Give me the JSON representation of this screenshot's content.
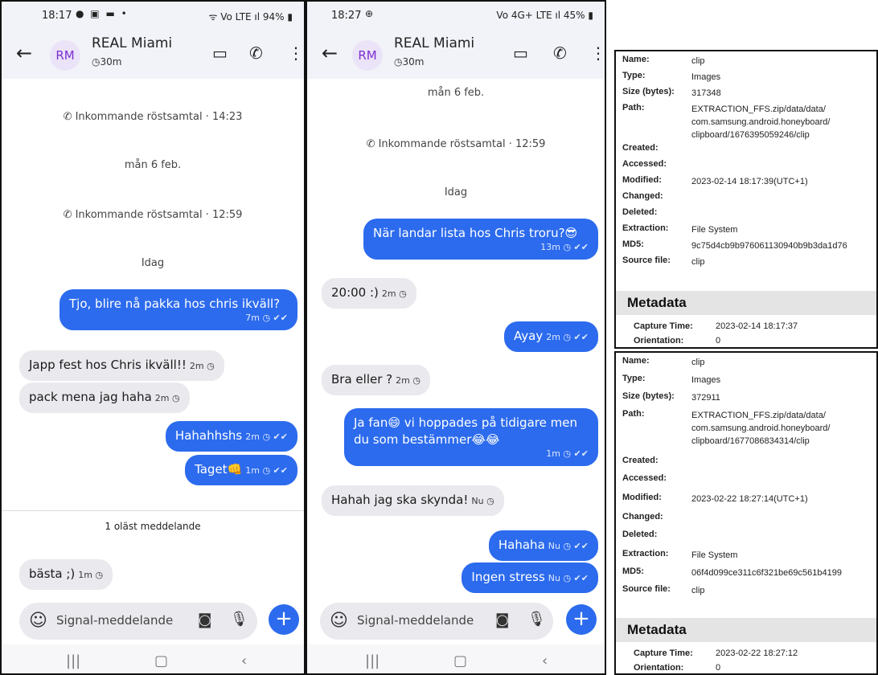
{
  "phone1": {
    "status": {
      "time": "18:17",
      "icons": "● ▣ ▬ •",
      "right": "ᯤ Vo LTE ıl 94% ▮"
    },
    "header": {
      "avatar": "RM",
      "contact": "REAL Miami",
      "timer": "30m"
    },
    "system": [
      {
        "text": "Inkommande röstsamtal · 14:23",
        "icon": "incoming-call-icon"
      },
      {
        "text": "mån 6 feb."
      },
      {
        "text": "Inkommande röstsamtal · 12:59",
        "icon": "incoming-call-icon"
      },
      {
        "text": "Idag"
      }
    ],
    "messages": [
      {
        "text": "Tjo, blire nå pakka hos chris ikväll?",
        "meta": "7m ◷ ✔✔",
        "dir": "out"
      },
      {
        "text": "Japp fest hos Chris ikväll!!",
        "meta": "2m ◷",
        "dir": "in"
      },
      {
        "text": "pack mena jag haha",
        "meta": "2m ◷",
        "dir": "in"
      },
      {
        "text": "Hahahhshs",
        "meta": "2m ◷ ✔✔",
        "dir": "out"
      },
      {
        "text": "Taget👊",
        "meta": "1m ◷ ✔✔",
        "dir": "out"
      },
      {
        "text": "bästa ;)",
        "meta": "1m ◷",
        "dir": "in"
      }
    ],
    "unread": "1 oläst meddelande",
    "composer_placeholder": "Signal-meddelande"
  },
  "phone2": {
    "status": {
      "time": "18:27",
      "icons": "⊕",
      "right": "Vo 4G+ LTE ıl 45% ▮"
    },
    "header": {
      "avatar": "RM",
      "contact": "REAL Miami",
      "timer": "30m"
    },
    "system": [
      {
        "text": "mån 6 feb."
      },
      {
        "text": "Inkommande röstsamtal · 12:59",
        "icon": "incoming-call-icon"
      },
      {
        "text": "Idag"
      }
    ],
    "messages": [
      {
        "text": "När landar lista hos Chris troru?😎",
        "meta": "13m ◷ ✔✔",
        "dir": "out"
      },
      {
        "text": "20:00 :)",
        "meta": "2m ◷",
        "dir": "in"
      },
      {
        "text": "Ayay",
        "meta": "2m ◷ ✔✔",
        "dir": "out"
      },
      {
        "text": "Bra eller ?",
        "meta": "2m ◷",
        "dir": "in"
      },
      {
        "text": "Ja fan😄 vi hoppades på tidigare men du som bestämmer😂😂",
        "meta": "1m ◷ ✔✔",
        "dir": "out"
      },
      {
        "text": "Hahah jag ska skynda!",
        "meta": "Nu ◷",
        "dir": "in"
      },
      {
        "text": "Hahaha",
        "meta": "Nu ◷ ✔✔",
        "dir": "out"
      },
      {
        "text": "Ingen stress",
        "meta": "Nu ◷ ✔✔",
        "dir": "out"
      }
    ],
    "composer_placeholder": "Signal-meddelande"
  },
  "panel1": {
    "labels": {
      "name": "Name:",
      "type": "Type:",
      "size": "Size (bytes):",
      "path": "Path:",
      "created": "Created:",
      "accessed": "Accessed:",
      "modified": "Modified:",
      "changed": "Changed:",
      "deleted": "Deleted:",
      "extraction": "Extraction:",
      "md5": "MD5:",
      "source": "Source file:"
    },
    "values": {
      "name": "clip",
      "type": "Images",
      "size": "317348",
      "path": "EXTRACTION_FFS.zip/data/data/ com.samsung.android.honeyboard/ clipboard/1676395059246/clip",
      "modified": "2023-02-14 18:17:39(UTC+1)",
      "extraction": "File System",
      "md5": "9c75d4cb9b976061130940b9b3da1d76",
      "source": "clip"
    },
    "metadata_header": "Metadata",
    "meta_labels": {
      "capture": "Capture Time:",
      "orientation": "Orientation:"
    },
    "meta_values": {
      "capture": "2023-02-14 18:17:37",
      "orientation": "0"
    }
  },
  "panel2": {
    "labels": {
      "name": "Name:",
      "type": "Type:",
      "size": "Size (bytes):",
      "path": "Path:",
      "created": "Created:",
      "accessed": "Accessed:",
      "modified": "Modified:",
      "changed": "Changed:",
      "deleted": "Deleted:",
      "extraction": "Extraction:",
      "md5": "MD5:",
      "source": "Source file:"
    },
    "values": {
      "name": "clip",
      "type": "Images",
      "size": "372911",
      "path": "EXTRACTION_FFS.zip/data/data/ com.samsung.android.honeyboard/ clipboard/1677086834314/clip",
      "modified": "2023-02-22 18:27:14(UTC+1)",
      "extraction": "File System",
      "md5": "06f4d099ce311c6f321be69c561b4199",
      "source": "clip"
    },
    "metadata_header": "Metadata",
    "meta_labels": {
      "capture": "Capture Time:",
      "orientation": "Orientation:"
    },
    "meta_values": {
      "capture": "2023-02-22 18:27:12",
      "orientation": "0"
    }
  },
  "colors": {
    "accent": "#2c6bed",
    "incoming_bubble": "#e9e9ee",
    "header_bg": "#f1f3f8",
    "avatar_text": "#7b2fd1",
    "panel_header_bg": "#e4e4e4"
  },
  "icons": [
    "back-arrow-icon",
    "timer-icon",
    "video-call-icon",
    "phone-icon",
    "more-icon",
    "emoji-icon",
    "camera-icon",
    "mic-icon",
    "plus-icon",
    "recents-icon",
    "home-icon",
    "nav-back-icon",
    "incoming-call-icon"
  ]
}
